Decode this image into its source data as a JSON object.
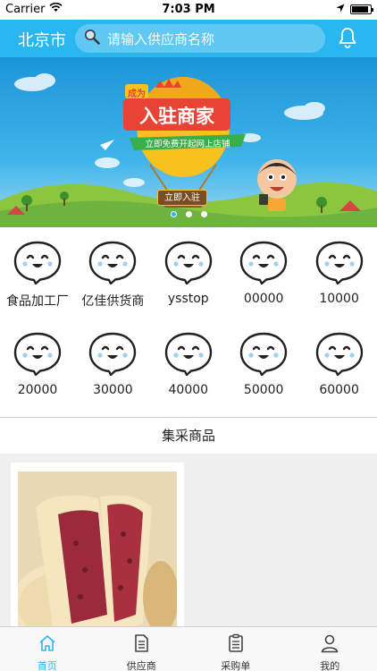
{
  "status_bar": {
    "carrier": "Carrier",
    "time": "7:03 PM",
    "battery_level": 0.9
  },
  "nav": {
    "city": "北京市",
    "search_placeholder": "请输入供应商名称",
    "search_icon": "magnifier-icon",
    "bell_icon": "bell-icon"
  },
  "banner": {
    "tag": "成为",
    "title": "入驻商家",
    "ribbon_text": "立即免费开起网上店铺",
    "button": "立即入驻",
    "dots": 3,
    "active_dot": 0
  },
  "suppliers": [
    {
      "label": "食品加工厂"
    },
    {
      "label": "亿佳供货商"
    },
    {
      "label": "ysstop"
    },
    {
      "label": "00000"
    },
    {
      "label": "10000"
    },
    {
      "label": "20000"
    },
    {
      "label": "30000"
    },
    {
      "label": "40000"
    },
    {
      "label": "50000"
    },
    {
      "label": "60000"
    }
  ],
  "section": {
    "title": "集采商品"
  },
  "tabs": [
    {
      "label": "首页",
      "icon": "home-icon"
    },
    {
      "label": "供应商",
      "icon": "document-icon"
    },
    {
      "label": "采购单",
      "icon": "clipboard-icon"
    },
    {
      "label": "我的",
      "icon": "person-icon"
    }
  ],
  "colors": {
    "primary": "#2ab7ef",
    "text": "#222222",
    "muted_bg": "#f0f0f0"
  }
}
